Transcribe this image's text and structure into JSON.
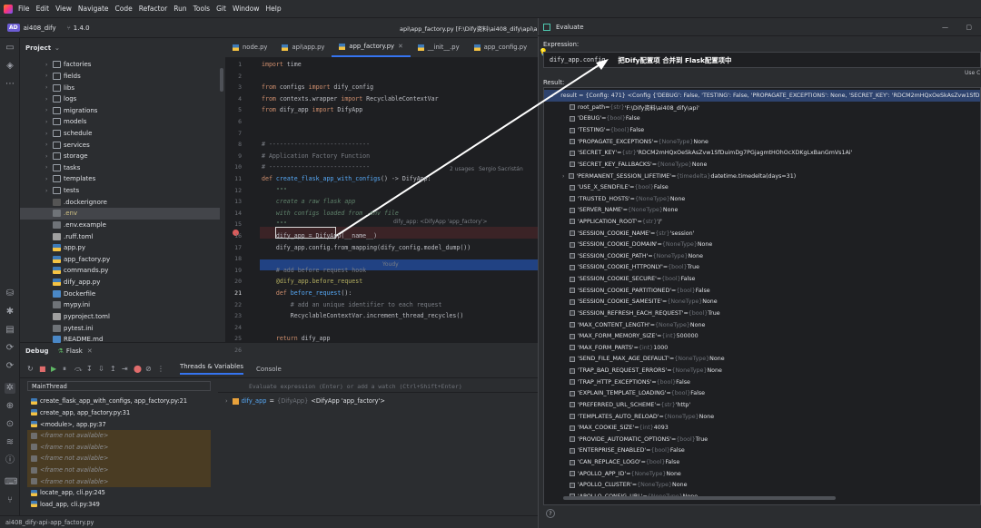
{
  "menu": {
    "items": [
      "File",
      "Edit",
      "View",
      "Navigate",
      "Code",
      "Refactor",
      "Run",
      "Tools",
      "Git",
      "Window",
      "Help"
    ]
  },
  "toolbar": {
    "project_badge": "AD",
    "project": "ai408_dify",
    "version": "1.4.0",
    "title_path": "api\\app_factory.py [F:\\Dify资料\\ai408_dify\\api\\a"
  },
  "project_panel": {
    "title": "Project",
    "items": [
      {
        "name": "factories",
        "type": "folder",
        "arrow": "›"
      },
      {
        "name": "fields",
        "type": "folder",
        "arrow": "›"
      },
      {
        "name": "libs",
        "type": "folder",
        "arrow": "›"
      },
      {
        "name": "logs",
        "type": "folder",
        "arrow": "›"
      },
      {
        "name": "migrations",
        "type": "folder",
        "arrow": "›"
      },
      {
        "name": "models",
        "type": "folder",
        "arrow": "›"
      },
      {
        "name": "schedule",
        "type": "folder",
        "arrow": "›"
      },
      {
        "name": "services",
        "type": "folder",
        "arrow": "›"
      },
      {
        "name": "storage",
        "type": "folder",
        "arrow": "›"
      },
      {
        "name": "tasks",
        "type": "folder",
        "arrow": "›"
      },
      {
        "name": "templates",
        "type": "folder",
        "arrow": "›"
      },
      {
        "name": "tests",
        "type": "folder",
        "arrow": "›"
      },
      {
        "name": ".dockerignore",
        "type": "ignore",
        "arrow": ""
      },
      {
        "name": ".env",
        "type": "text",
        "arrow": "",
        "selected": true
      },
      {
        "name": ".env.example",
        "type": "text",
        "arrow": ""
      },
      {
        "name": ".ruff.toml",
        "type": "toml",
        "arrow": ""
      },
      {
        "name": "app.py",
        "type": "python",
        "arrow": ""
      },
      {
        "name": "app_factory.py",
        "type": "python",
        "arrow": ""
      },
      {
        "name": "commands.py",
        "type": "python",
        "arrow": ""
      },
      {
        "name": "dify_app.py",
        "type": "python",
        "arrow": ""
      },
      {
        "name": "Dockerfile",
        "type": "docker",
        "arrow": ""
      },
      {
        "name": "mypy.ini",
        "type": "text",
        "arrow": ""
      },
      {
        "name": "pyproject.toml",
        "type": "toml",
        "arrow": ""
      },
      {
        "name": "pytest.ini",
        "type": "text",
        "arrow": ""
      },
      {
        "name": "README.md",
        "type": "md",
        "arrow": ""
      }
    ]
  },
  "editor": {
    "tabs": [
      {
        "label": "node.py"
      },
      {
        "label": "api\\app.py"
      },
      {
        "label": "app_factory.py",
        "active": true
      },
      {
        "label": "__init__.py"
      },
      {
        "label": "app_config.py"
      }
    ],
    "lines": [
      {
        "n": "1",
        "html": "<span class='kw'>import</span> time"
      },
      {
        "n": "2",
        "html": ""
      },
      {
        "n": "3",
        "html": "<span class='kw'>from</span> configs <span class='kw'>import</span> dify_config"
      },
      {
        "n": "4",
        "html": "<span class='kw'>from</span> contexts.wrapper <span class='kw'>import</span> RecyclableContextVar"
      },
      {
        "n": "5",
        "html": "<span class='kw'>from</span> dify_app <span class='kw'>import</span> DifyApp"
      },
      {
        "n": "6",
        "html": ""
      },
      {
        "n": "7",
        "html": ""
      },
      {
        "n": "8",
        "html": "<span class='cm'># ----------------------------</span>"
      },
      {
        "n": "9",
        "html": "<span class='cm'># Application Factory Function</span>"
      },
      {
        "n": "10",
        "html": "<span class='cm'># ----------------------------</span>"
      },
      {
        "n": "11",
        "html": "<span class='kw'>def</span> <span class='fn'>create_flask_app_with_configs</span>() -> DifyApp:"
      },
      {
        "n": "12",
        "html": "    <span class='it'>\"\"\"</span>"
      },
      {
        "n": "13",
        "html": "    <span class='it'>create a raw flask app</span>"
      },
      {
        "n": "14",
        "html": "    <span class='it'>with configs loaded from .env file</span>"
      },
      {
        "n": "15",
        "html": "    <span class='it'>\"\"\"</span>"
      },
      {
        "n": "16",
        "html": "    dify_app = DifyApp(__name__)"
      },
      {
        "n": "17",
        "html": "    dify_app.config.from_mapping(dify_config.model_dump())"
      },
      {
        "n": "18",
        "html": ""
      },
      {
        "n": "19",
        "html": "    <span class='cm'># add before request hook</span>"
      },
      {
        "n": "20",
        "html": "    <span class='dc'>@dify_app.before_request</span>"
      },
      {
        "n": "21",
        "html": "    <span class='kw'>def</span> <span class='fn'>before_request</span>():"
      },
      {
        "n": "22",
        "html": "        <span class='cm'># add an unique identifier to each request</span>"
      },
      {
        "n": "23",
        "html": "        RecyclableContextVar.increment_thread_recycles()"
      },
      {
        "n": "24",
        "html": ""
      },
      {
        "n": "25",
        "html": "    <span class='kw'>return</span> dify_app"
      },
      {
        "n": "26",
        "html": ""
      }
    ],
    "hint_usages": "2 usages",
    "hint_author": "Sergio Sacristán",
    "hint_var": "dify_app: <DifyApp 'app_factory'>",
    "hint_youdy": "Youdy"
  },
  "debug": {
    "title": "Debug",
    "config": "Flask",
    "tab_threads": "Threads & Variables",
    "tab_console": "Console",
    "thread": "MainThread",
    "frames": [
      {
        "label": "create_flask_app_with_configs, app_factory.py:21",
        "na": false
      },
      {
        "label": "create_app, app_factory.py:31",
        "na": false
      },
      {
        "label": "<module>, app.py:37",
        "na": false
      },
      {
        "label": "<frame not available>",
        "na": true
      },
      {
        "label": "<frame not available>",
        "na": true
      },
      {
        "label": "<frame not available>",
        "na": true
      },
      {
        "label": "<frame not available>",
        "na": true
      },
      {
        "label": "<frame not available>",
        "na": true
      },
      {
        "label": "locate_app, cli.py:245",
        "na": false
      },
      {
        "label": "load_app, cli.py:349",
        "na": false
      }
    ],
    "eval_placeholder": "Evaluate expression (Enter) or add a watch (Ctrl+Shift+Enter)",
    "var_name": "dify_app",
    "var_type": "{DifyApp}",
    "var_value": "<DifyApp 'app_factory'>"
  },
  "statusbar": {
    "crumbs": [
      "ai408_dify",
      "api",
      "app_factory.py"
    ]
  },
  "evaluate": {
    "title": "Evaluate",
    "expression_label": "Expression:",
    "expression": "dify_app.config",
    "annotation": "把Dify配置项 合并到 Flask配置项中",
    "result_label": "Result:",
    "use_label": "Use C",
    "result_header": "result = {Config: 471} <Config {'DEBUG': False, 'TESTING': False, 'PROPAGATE_EXCEPTIONS': None, 'SECRET_KEY': 'RDCM2mHQxOeSkAsZvw1SfDuimD",
    "rows": [
      {
        "k": "root_path",
        "t": "{str}",
        "v": "'F:\\Dify资料\\ai408_dify\\api'"
      },
      {
        "k": "'DEBUG'",
        "t": "{bool}",
        "v": "False"
      },
      {
        "k": "'TESTING'",
        "t": "{bool}",
        "v": "False"
      },
      {
        "k": "'PROPAGATE_EXCEPTIONS'",
        "t": "{NoneType}",
        "v": "None"
      },
      {
        "k": "'SECRET_KEY'",
        "t": "{str}",
        "v": "'RDCM2mHQxOeSkAsZvw1SfDuimDg7PGjagmtHOhOcXDKgLxBanGmVs1Ai'"
      },
      {
        "k": "'SECRET_KEY_FALLBACKS'",
        "t": "{NoneType}",
        "v": "None"
      },
      {
        "k": "'PERMANENT_SESSION_LIFETIME'",
        "t": "{timedelta}",
        "v": "datetime.timedelta(days=31)",
        "exp": true
      },
      {
        "k": "'USE_X_SENDFILE'",
        "t": "{bool}",
        "v": "False"
      },
      {
        "k": "'TRUSTED_HOSTS'",
        "t": "{NoneType}",
        "v": "None"
      },
      {
        "k": "'SERVER_NAME'",
        "t": "{NoneType}",
        "v": "None"
      },
      {
        "k": "'APPLICATION_ROOT'",
        "t": "{str}",
        "v": "'/'"
      },
      {
        "k": "'SESSION_COOKIE_NAME'",
        "t": "{str}",
        "v": "'session'"
      },
      {
        "k": "'SESSION_COOKIE_DOMAIN'",
        "t": "{NoneType}",
        "v": "None"
      },
      {
        "k": "'SESSION_COOKIE_PATH'",
        "t": "{NoneType}",
        "v": "None"
      },
      {
        "k": "'SESSION_COOKIE_HTTPONLY'",
        "t": "{bool}",
        "v": "True"
      },
      {
        "k": "'SESSION_COOKIE_SECURE'",
        "t": "{bool}",
        "v": "False"
      },
      {
        "k": "'SESSION_COOKIE_PARTITIONED'",
        "t": "{bool}",
        "v": "False"
      },
      {
        "k": "'SESSION_COOKIE_SAMESITE'",
        "t": "{NoneType}",
        "v": "None"
      },
      {
        "k": "'SESSION_REFRESH_EACH_REQUEST'",
        "t": "{bool}",
        "v": "True"
      },
      {
        "k": "'MAX_CONTENT_LENGTH'",
        "t": "{NoneType}",
        "v": "None"
      },
      {
        "k": "'MAX_FORM_MEMORY_SIZE'",
        "t": "{int}",
        "v": "500000"
      },
      {
        "k": "'MAX_FORM_PARTS'",
        "t": "{int}",
        "v": "1000"
      },
      {
        "k": "'SEND_FILE_MAX_AGE_DEFAULT'",
        "t": "{NoneType}",
        "v": "None"
      },
      {
        "k": "'TRAP_BAD_REQUEST_ERRORS'",
        "t": "{NoneType}",
        "v": "None"
      },
      {
        "k": "'TRAP_HTTP_EXCEPTIONS'",
        "t": "{bool}",
        "v": "False"
      },
      {
        "k": "'EXPLAIN_TEMPLATE_LOADING'",
        "t": "{bool}",
        "v": "False"
      },
      {
        "k": "'PREFERRED_URL_SCHEME'",
        "t": "{str}",
        "v": "'http'"
      },
      {
        "k": "'TEMPLATES_AUTO_RELOAD'",
        "t": "{NoneType}",
        "v": "None"
      },
      {
        "k": "'MAX_COOKIE_SIZE'",
        "t": "{int}",
        "v": "4093"
      },
      {
        "k": "'PROVIDE_AUTOMATIC_OPTIONS'",
        "t": "{bool}",
        "v": "True"
      },
      {
        "k": "'ENTERPRISE_ENABLED'",
        "t": "{bool}",
        "v": "False"
      },
      {
        "k": "'CAN_REPLACE_LOGO'",
        "t": "{bool}",
        "v": "False"
      },
      {
        "k": "'APOLLO_APP_ID'",
        "t": "{NoneType}",
        "v": "None"
      },
      {
        "k": "'APOLLO_CLUSTER'",
        "t": "{NoneType}",
        "v": "None"
      },
      {
        "k": "'APOLLO_CONFIG_URL'",
        "t": "{NoneType}",
        "v": "None"
      }
    ],
    "help": "?"
  },
  "colors": {
    "accent": "#3574f0",
    "breakpoint": "#db5c5c",
    "arrow": "#ffffff"
  }
}
